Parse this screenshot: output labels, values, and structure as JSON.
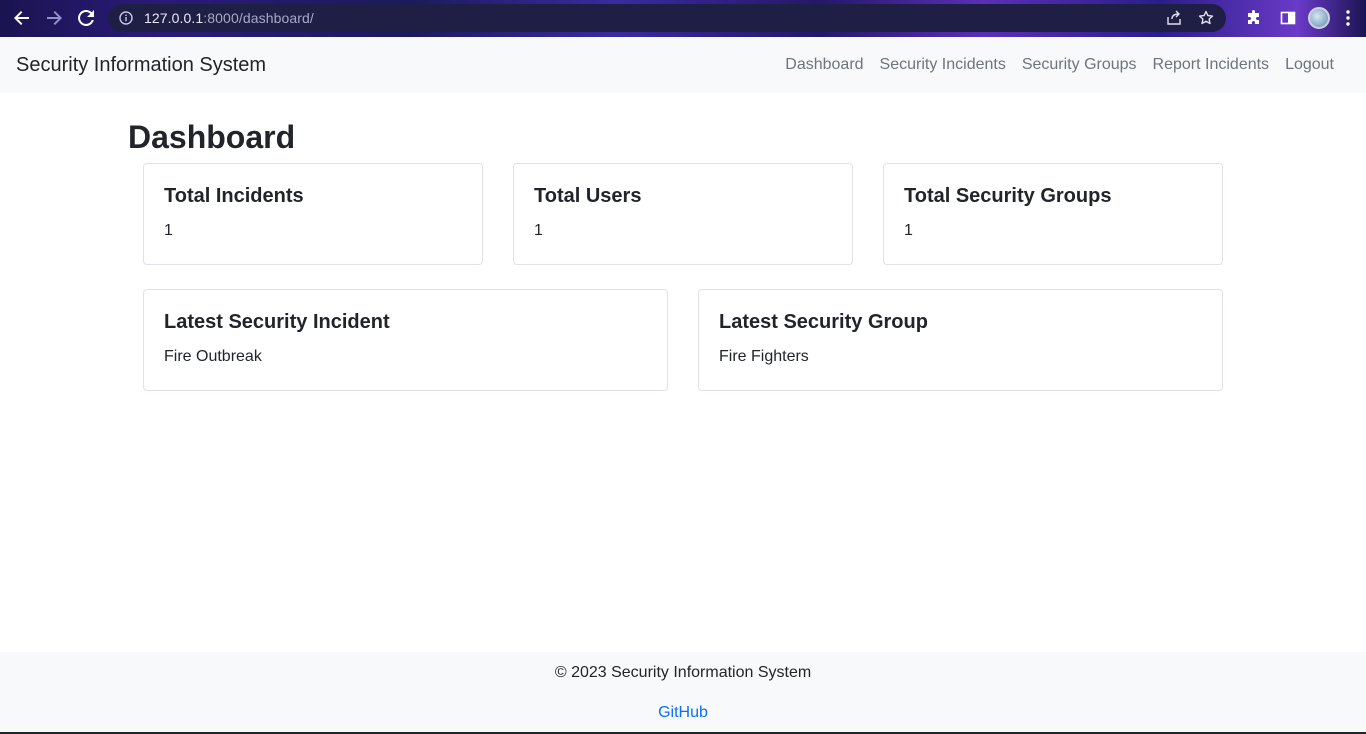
{
  "browser": {
    "url_host": "127.0.0.1",
    "url_rest": ":8000/dashboard/",
    "icons": [
      "back-arrow-icon",
      "forward-arrow-icon",
      "reload-icon",
      "info-icon",
      "share-icon",
      "star-icon",
      "puzzle-icon",
      "side-panel-icon",
      "profile-avatar",
      "more-vert-icon"
    ]
  },
  "navbar": {
    "brand": "Security Information System",
    "links": [
      "Dashboard",
      "Security Incidents",
      "Security Groups",
      "Report Incidents",
      "Logout"
    ]
  },
  "page": {
    "title": "Dashboard"
  },
  "cards": {
    "total_incidents": {
      "title": "Total Incidents",
      "value": "1"
    },
    "total_users": {
      "title": "Total Users",
      "value": "1"
    },
    "total_groups": {
      "title": "Total Security Groups",
      "value": "1"
    },
    "latest_incident": {
      "title": "Latest Security Incident",
      "value": "Fire Outbreak"
    },
    "latest_group": {
      "title": "Latest Security Group",
      "value": "Fire Fighters"
    }
  },
  "footer": {
    "copyright": "© 2023 Security Information System",
    "link": "GitHub"
  },
  "colors": {
    "navbar_bg": "#f8f9fa",
    "link": "#0d6efd",
    "nav_link": "#6c757d"
  }
}
